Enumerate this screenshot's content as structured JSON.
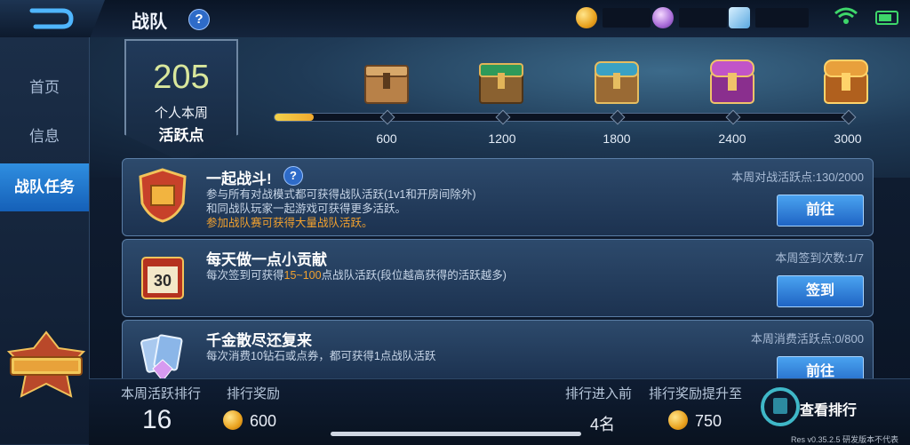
{
  "header": {
    "title": "战队",
    "help": "?"
  },
  "sidebar": {
    "items": [
      {
        "label": "首页",
        "active": false
      },
      {
        "label": "信息",
        "active": false
      },
      {
        "label": "战队任务",
        "active": true
      }
    ]
  },
  "score": {
    "value": "205",
    "line1": "个人本周",
    "line2": "活跃点"
  },
  "milestones": [
    "600",
    "1200",
    "1800",
    "2400",
    "3000"
  ],
  "progress": {
    "current": 205,
    "max": 3000
  },
  "tasks": [
    {
      "title": "一起战斗!",
      "help": "?",
      "right": "本周对战活跃点:130/2000",
      "desc1": "参与所有对战模式都可获得战队活跃(1v1和开房间除外)",
      "desc2": "和同战队玩家一起游戏可获得更多活跃。",
      "desc3": "参加战队赛可获得大量战队活跃。",
      "button": "前往"
    },
    {
      "title": "每天做一点小贡献",
      "right": "本周签到次数:1/7",
      "desc_pre": "每次签到可获得",
      "desc_hl": "15~100",
      "desc_post": "点战队活跃(段位越高获得的活跃越多)",
      "button": "签到"
    },
    {
      "title": "千金散尽还复来",
      "right": "本周消费活跃点:0/800",
      "desc1": "每次消费10钻石或点券，都可获得1点战队活跃",
      "button": "前往"
    }
  ],
  "bottom": {
    "rank_label": "本周活跃排行",
    "rank_value": "16",
    "reward_label": "排行奖励",
    "reward_value": "600",
    "enter_label": "排行进入前",
    "enter_value": "4名",
    "up_label": "排行奖励提升至",
    "up_value": "750",
    "view_button": "查看排行"
  },
  "version": "Res v0.35.2.5 研发版本不代表",
  "colors": {
    "accent": "#2f8ee0",
    "highlight": "#f2a12e",
    "progress": "#f3d24b",
    "wifi": "#3ed66a"
  }
}
